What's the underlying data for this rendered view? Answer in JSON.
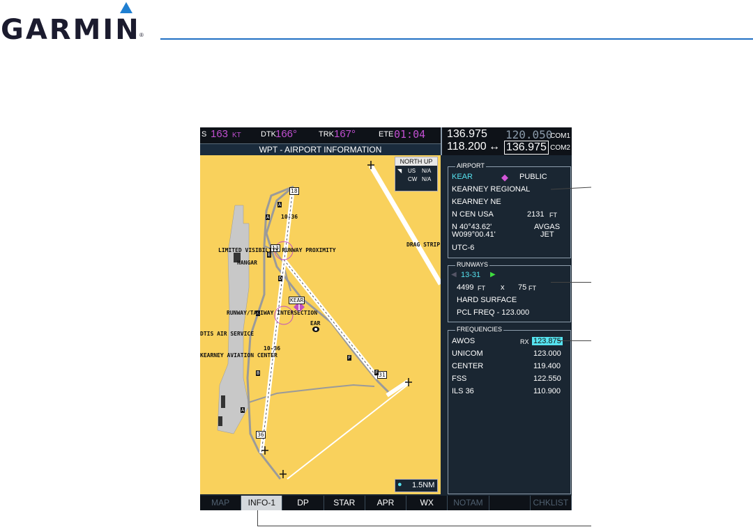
{
  "brand": {
    "name": "GARMIN",
    "reg": "®",
    "accent": "#1f7fd1"
  },
  "navbar": {
    "gs_label": "S",
    "gs_value": "163",
    "gs_unit": "KT",
    "dtk_label": "DTK",
    "dtk_value": "166°",
    "trk_label": "TRK",
    "trk_value": "167°",
    "ete_label": "ETE",
    "ete_value": "01:04"
  },
  "page_title": "WPT - AIRPORT INFORMATION",
  "com": {
    "com1_active": "136.975",
    "com1_standby": "120.050",
    "com1_label": "COM1",
    "com2_active": "118.200",
    "swap_icon": "↔",
    "com2_standby": "136.975",
    "com2_label": "COM2"
  },
  "map": {
    "orientation": "NORTH UP",
    "us_label": "US",
    "us_value": "N/A",
    "cw_label": "CW",
    "cw_value": "N/A",
    "range": "1.5NM",
    "labels": {
      "limited_visibility": "LIMITED VISIBILITY RUNWAY PROXIMITY",
      "hangar": "HANGAR",
      "runway_intersection": "RUNWAY/TAXIWAY INTERSECTION",
      "kear": "KEAR",
      "ear": "EAR",
      "dtis": "DTIS AIR SERVICE",
      "kearney_aviation": "KEARNEY AVIATION CENTER",
      "drag_strip": "DRAG STRIP",
      "rwy_18": "18",
      "rwy_13": "13",
      "rwy_36": "36",
      "rwy_31": "31",
      "label_10_36": "10-36",
      "label_10_36b": "10-36",
      "tw_a": "A",
      "tw_b": "B",
      "tw_e": "E",
      "tw_f": "F",
      "tw_d": "D"
    }
  },
  "airport": {
    "section_title": "AIRPORT",
    "ident": "KEAR",
    "type": "PUBLIC",
    "name": "KEARNEY REGIONAL",
    "city": "KEARNEY NE",
    "region": "N CEN USA",
    "elevation": "2131",
    "elevation_unit": "FT",
    "lat": "N 40°43.62'",
    "lon": "W099°00.41'",
    "fuel1": "AVGAS",
    "fuel2": "JET",
    "timezone": "UTC-6"
  },
  "runways": {
    "section_title": "RUNWAYS",
    "runway": "13-31",
    "length": "4499",
    "length_unit": "FT",
    "x": "x",
    "width": "75",
    "width_unit": "FT",
    "surface": "HARD SURFACE",
    "pcl": "PCL FREQ - 123.000"
  },
  "frequencies": {
    "section_title": "FREQUENCIES",
    "items": [
      {
        "name": "AWOS",
        "prefix": "RX",
        "freq": "123.875"
      },
      {
        "name": "UNICOM",
        "prefix": "",
        "freq": "123.000"
      },
      {
        "name": "CENTER",
        "prefix": "",
        "freq": "119.400"
      },
      {
        "name": "FSS",
        "prefix": "",
        "freq": "122.550"
      },
      {
        "name": "ILS 36",
        "prefix": "",
        "freq": "110.900"
      }
    ]
  },
  "softkeys": [
    "MAP",
    "INFO-1",
    "DP",
    "STAR",
    "APR",
    "WX",
    "NOTAM",
    "",
    "CHKLIST"
  ]
}
